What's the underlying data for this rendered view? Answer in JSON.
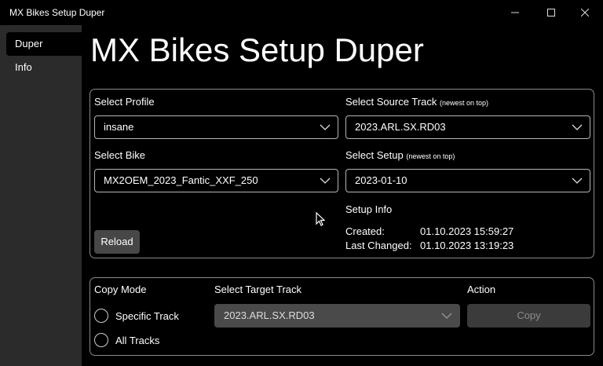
{
  "window": {
    "title": "MX Bikes Setup Duper"
  },
  "sidebar": {
    "items": [
      {
        "label": "Duper"
      },
      {
        "label": "Info"
      }
    ]
  },
  "main": {
    "title": "MX Bikes Setup Duper",
    "profile": {
      "label": "Select Profile",
      "value": "insane"
    },
    "source_track": {
      "label": "Select Source Track",
      "hint": "(newest on top)",
      "value": "2023.ARL.SX.RD03"
    },
    "bike": {
      "label": "Select Bike",
      "value": "MX2OEM_2023_Fantic_XXF_250"
    },
    "setup": {
      "label": "Select Setup",
      "hint": "(newest on top)",
      "value": "2023-01-10"
    },
    "setup_info": {
      "heading": "Setup Info",
      "created_label": "Created:",
      "created_value": "01.10.2023 15:59:27",
      "changed_label": "Last Changed:",
      "changed_value": "01.10.2023 13:19:23"
    },
    "reload_label": "Reload",
    "copy": {
      "mode_label": "Copy Mode",
      "options": [
        {
          "label": "Specific Track"
        },
        {
          "label": "All Tracks"
        }
      ],
      "target_label": "Select Target Track",
      "target_value": "2023.ARL.SX.RD03",
      "action_label": "Action",
      "copy_label": "Copy"
    }
  },
  "colors": {
    "sidebar_bg": "#2b2b2b",
    "panel_border": "#8a8a8a",
    "button_bg": "#474747",
    "disabled_bg": "#4a4a4a"
  }
}
